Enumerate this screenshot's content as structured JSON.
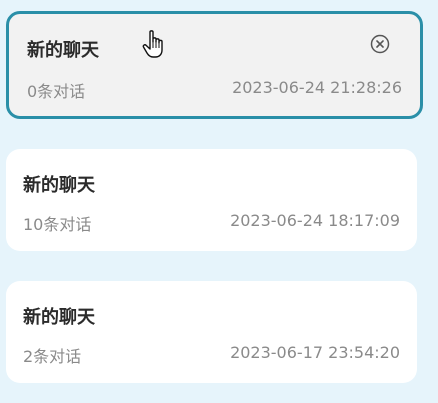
{
  "conversations": [
    {
      "title": "新的聊天",
      "count_text": "0条对话",
      "timestamp": "2023-06-24 21:28:26",
      "active": true
    },
    {
      "title": "新的聊天",
      "count_text": "10条对话",
      "timestamp": "2023-06-24 18:17:09",
      "active": false
    },
    {
      "title": "新的聊天",
      "count_text": "2条对话",
      "timestamp": "2023-06-17 23:54:20",
      "active": false
    }
  ],
  "icons": {
    "close": "close-circle-icon",
    "cursor": "hand-pointer-cursor"
  },
  "colors": {
    "page_background": "#e6f4fb",
    "card_background": "#ffffff",
    "active_card_background": "#f2f2f2",
    "active_border": "#2a8fa8",
    "title_text": "#2b2b2b",
    "meta_text": "#8a8a8a"
  }
}
